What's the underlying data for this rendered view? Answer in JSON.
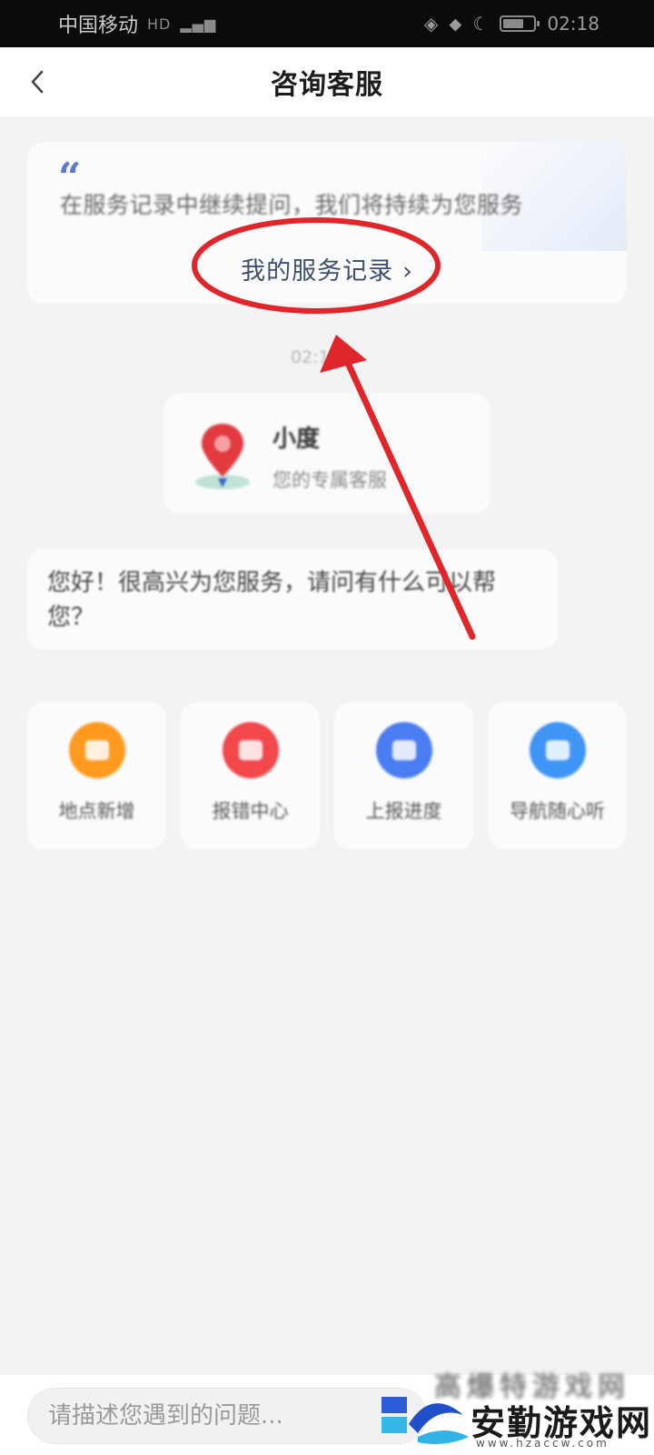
{
  "status_bar": {
    "carrier": "中国移动",
    "network_tag": "HD",
    "time": "02:18"
  },
  "header": {
    "title": "咨询客服"
  },
  "record_card": {
    "description": "在服务记录中继续提问，我们将持续为您服务",
    "link_label": "我的服务记录",
    "chevron": "›"
  },
  "chat": {
    "time_label": "02:1",
    "agent_name": "小度",
    "agent_subtitle": "您的专属客服",
    "greeting": "您好！很高兴为您服务，请问有什么可以帮您？"
  },
  "quick_actions": [
    {
      "label": "地点新增",
      "color": "#ff9a1f"
    },
    {
      "label": "报错中心",
      "color": "#f2474b"
    },
    {
      "label": "上报进度",
      "color": "#4a7cf2"
    },
    {
      "label": "导航随心听",
      "color": "#3f95f5"
    }
  ],
  "input": {
    "placeholder": "请描述您遇到的问题..."
  },
  "watermark": {
    "title": "安勤游戏网",
    "url": "www.hzaccw.com",
    "ghost_text": "高爆特游戏网"
  },
  "annotation": {
    "color": "#e0262b"
  }
}
